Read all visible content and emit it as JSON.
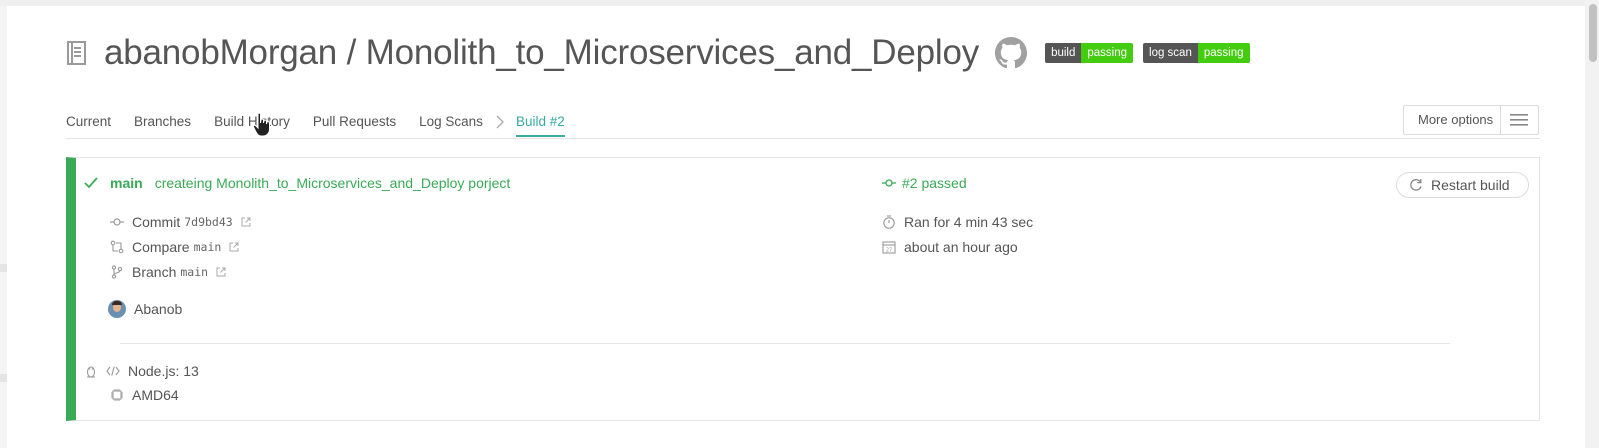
{
  "header": {
    "owner": "abanobMorgan",
    "separator": " / ",
    "repo": "Monolith_to_Microservices_and_Deploy",
    "badges": [
      {
        "label": "build",
        "status": "passing"
      },
      {
        "label": "log scan",
        "status": "passing"
      }
    ]
  },
  "tabs": [
    {
      "label": "Current"
    },
    {
      "label": "Branches"
    },
    {
      "label": "Build History"
    },
    {
      "label": "Pull Requests"
    },
    {
      "label": "Log Scans"
    },
    {
      "label": "Build #2",
      "active": true
    }
  ],
  "more_options": {
    "label": "More options"
  },
  "build": {
    "branch": "main",
    "message": "createing Monolith_to_Microservices_and_Deploy porject",
    "status_text": "#2 passed",
    "commit_label": "Commit",
    "commit_sha": "7d9bd43",
    "compare_label": "Compare",
    "compare_ref": "main",
    "branch_label": "Branch",
    "branch_ref": "main",
    "author": "Abanob",
    "duration": "Ran for 4 min 43 sec",
    "finished": "about an hour ago",
    "restart_label": "Restart build",
    "language": "Node.js: 13",
    "arch": "AMD64"
  },
  "colors": {
    "passed": "#39aa56",
    "accent": "#39aaa4",
    "badge_left": "#555555",
    "badge_right": "#44cc11"
  }
}
